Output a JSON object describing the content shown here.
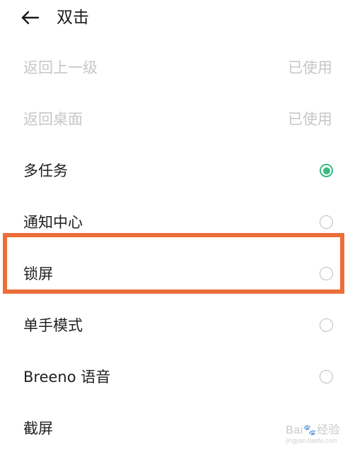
{
  "header": {
    "title": "双击",
    "back_icon": "arrow-left-icon"
  },
  "options": [
    {
      "label": "返回上一级",
      "status": "已使用",
      "disabled": true,
      "selected": false
    },
    {
      "label": "返回桌面",
      "status": "已使用",
      "disabled": true,
      "selected": false
    },
    {
      "label": "多任务",
      "status": "",
      "disabled": false,
      "selected": true
    },
    {
      "label": "通知中心",
      "status": "",
      "disabled": false,
      "selected": false
    },
    {
      "label": "锁屏",
      "status": "",
      "disabled": false,
      "selected": false
    },
    {
      "label": "单手模式",
      "status": "",
      "disabled": false,
      "selected": false
    },
    {
      "label": "Breeno 语音",
      "status": "",
      "disabled": false,
      "selected": false
    },
    {
      "label": "截屏",
      "status": "",
      "disabled": false,
      "selected": false
    }
  ],
  "watermark": {
    "text_left": "Bai",
    "text_right": "经验",
    "sub": "jingyan.baidu.com"
  },
  "colors": {
    "accent": "#39b980",
    "highlight": "#ec6d3a",
    "disabled_text": "#c7c7c7"
  }
}
